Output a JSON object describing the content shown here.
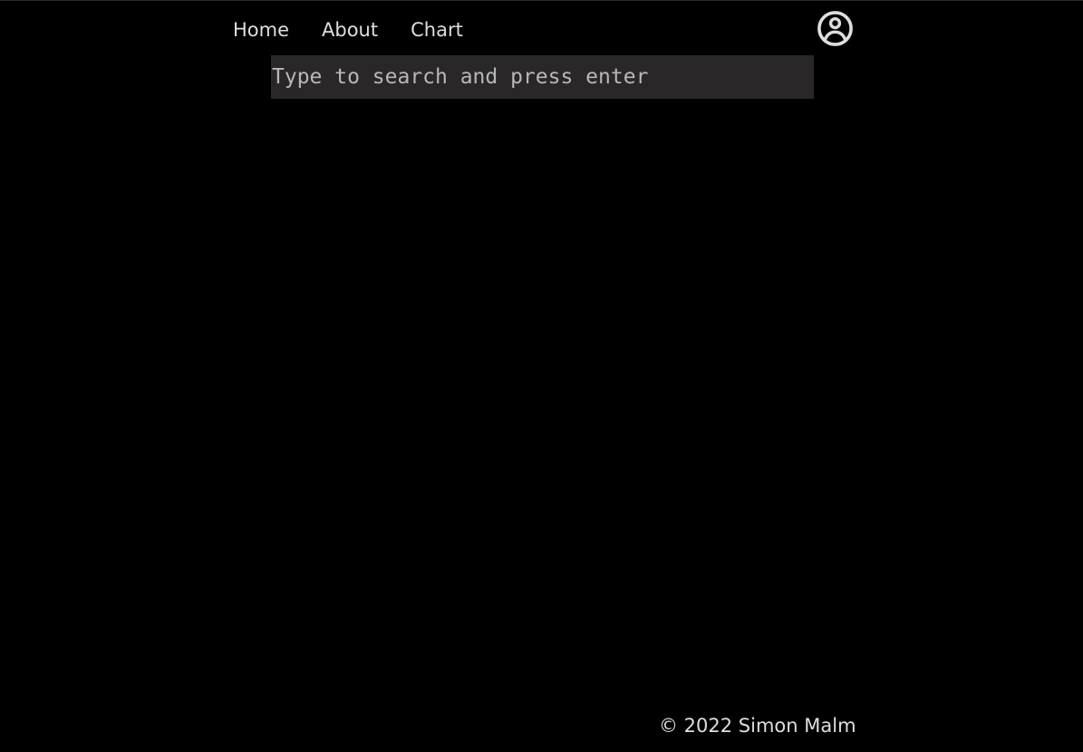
{
  "nav": {
    "items": [
      {
        "label": "Home"
      },
      {
        "label": "About"
      },
      {
        "label": "Chart"
      }
    ]
  },
  "header": {
    "user_icon": "user-circle-icon"
  },
  "search": {
    "placeholder": "Type to search and press enter",
    "value": ""
  },
  "footer": {
    "text": "© 2022 Simon Malm"
  },
  "colors": {
    "background": "#000000",
    "text": "#dedede",
    "search_bg": "#292727",
    "placeholder": "#b8b8b8"
  }
}
